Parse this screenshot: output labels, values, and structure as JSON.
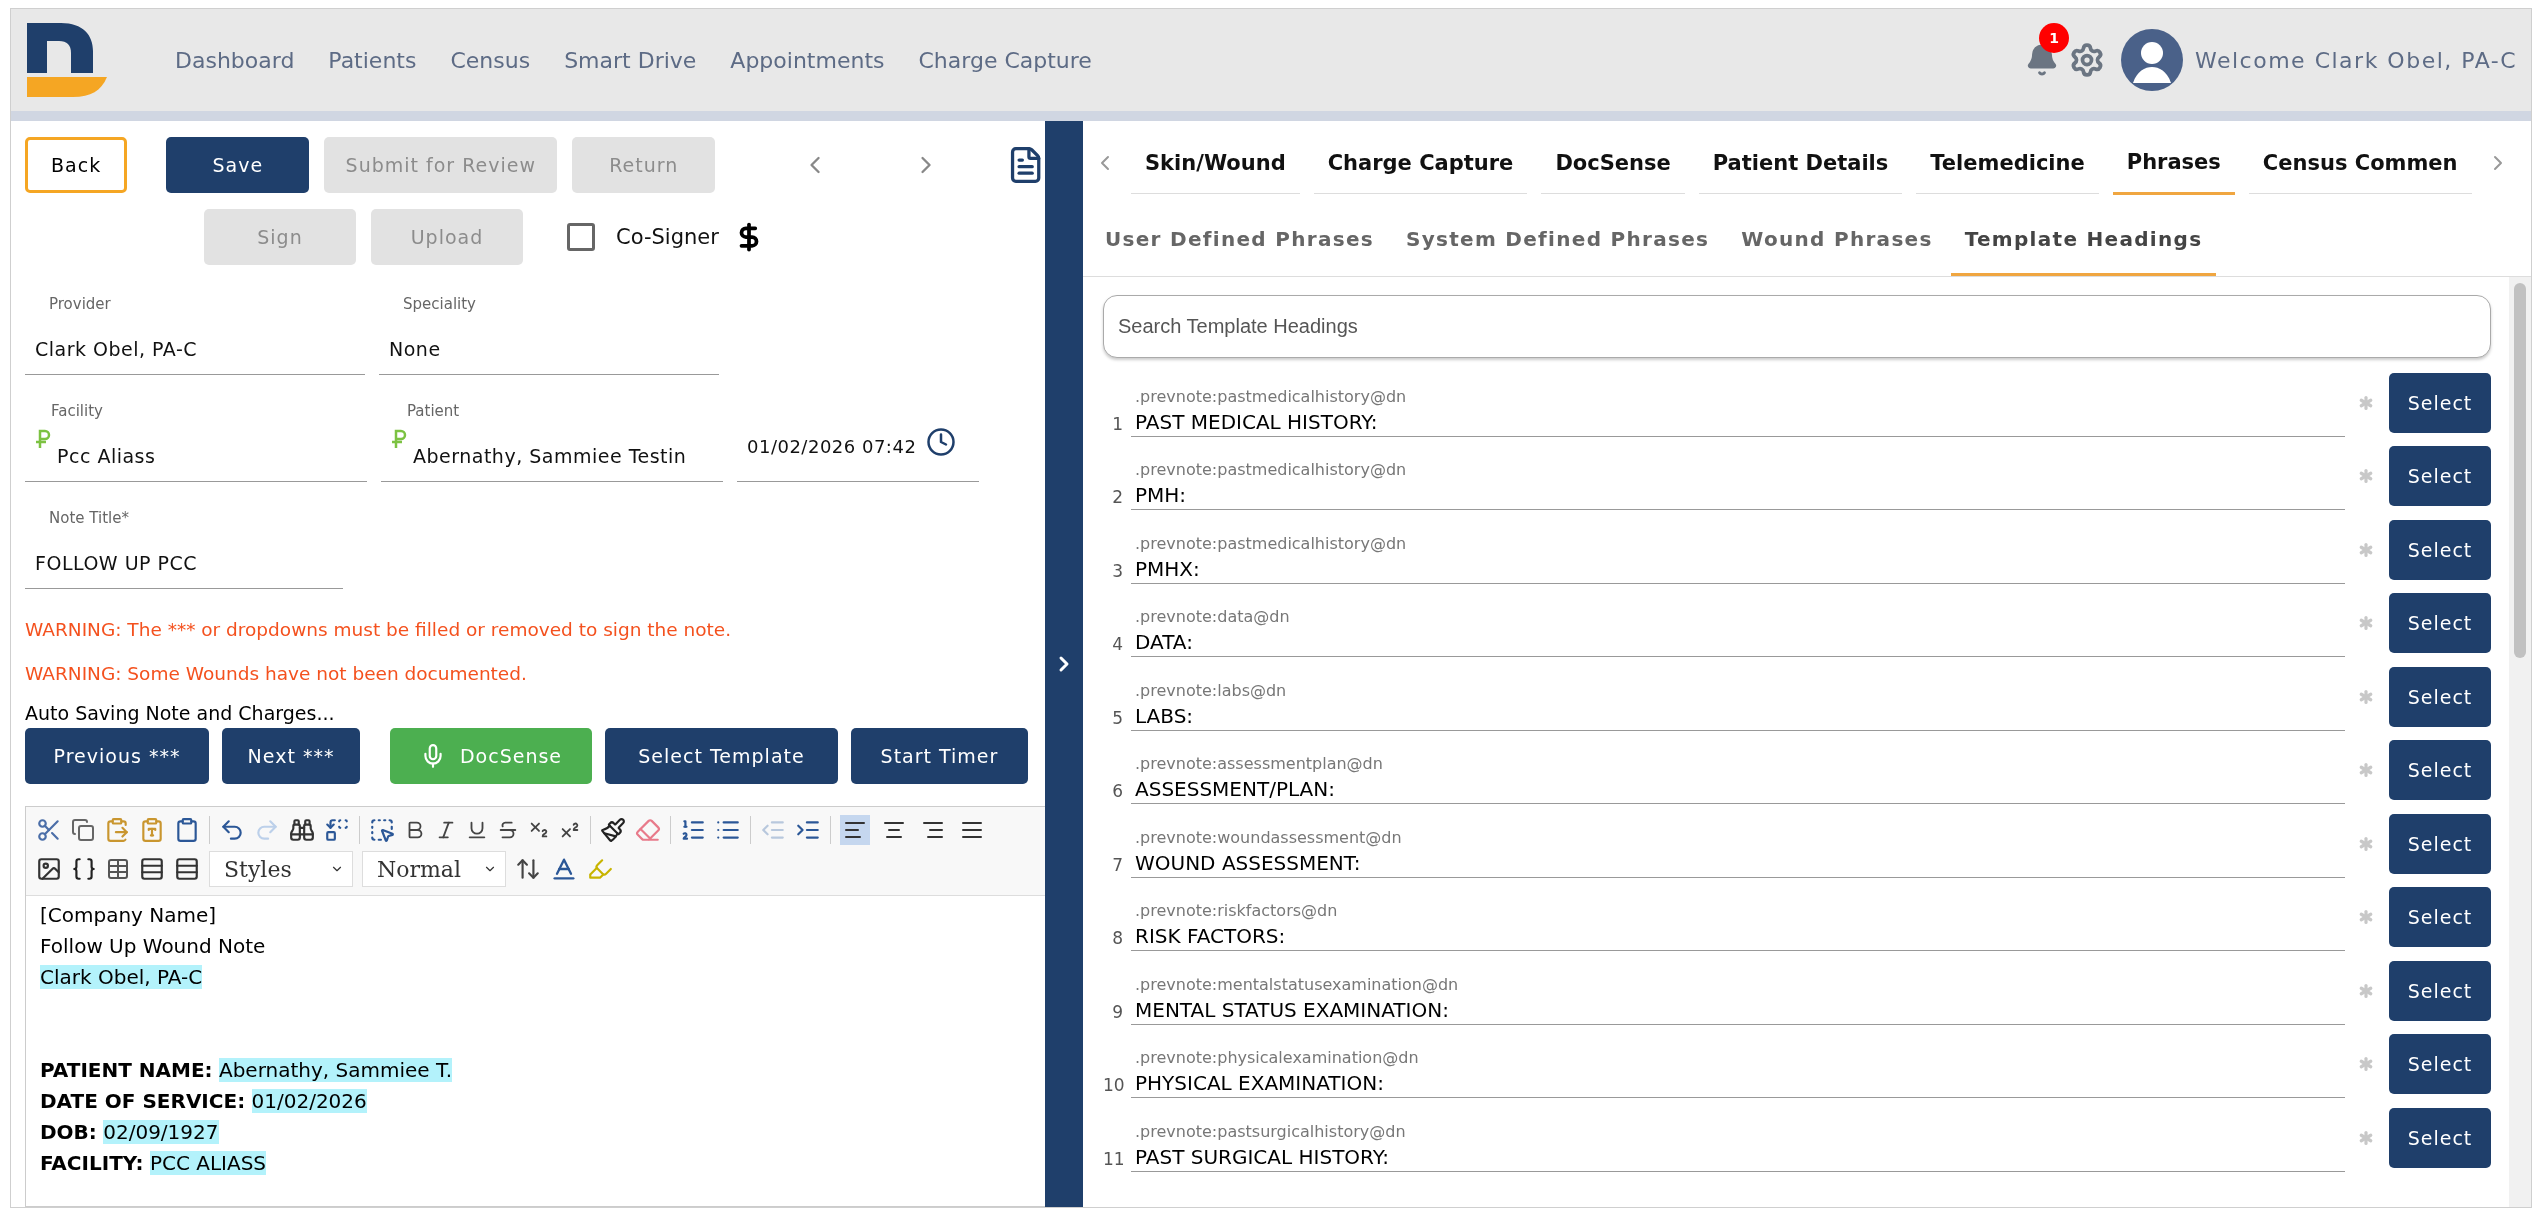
{
  "nav": {
    "items": [
      "Dashboard",
      "Patients",
      "Census",
      "Smart Drive",
      "Appointments",
      "Charge Capture"
    ],
    "notifications": "1",
    "welcome": "Welcome Clark Obel, PA-C"
  },
  "note": {
    "actions": [
      {
        "label": "Back",
        "kind": "outline",
        "disabled": false
      },
      {
        "label": "Save",
        "kind": "primary",
        "disabled": false
      },
      {
        "label": "Submit for Review",
        "kind": "primary",
        "disabled": true
      },
      {
        "label": "Return",
        "kind": "primary",
        "disabled": true
      }
    ],
    "actions_row2": [
      {
        "label": "Sign",
        "disabled": true
      },
      {
        "label": "Upload",
        "disabled": true
      }
    ],
    "cosigner": {
      "label": "Co-Signer",
      "checked": false
    },
    "field_rows": [
      [
        {
          "label": "Provider",
          "value": "Clark Obel, PA-C",
          "kind": "text"
        },
        {
          "label": "Speciality",
          "value": "None",
          "kind": "text"
        }
      ],
      [
        {
          "label": "Facility",
          "value": "Pcc Aliass",
          "kind": "linked"
        },
        {
          "label": "Patient",
          "value": "Abernathy, Sammiee Testin",
          "kind": "linked"
        },
        {
          "value": "01/02/2026 07:42",
          "kind": "date"
        }
      ],
      [
        {
          "label": "Note Title*",
          "value": "FOLLOW UP PCC",
          "kind": "text"
        }
      ]
    ],
    "warnings": [
      "WARNING: The *** or dropdowns must be filled or removed to sign the note.",
      "WARNING: Some Wounds have not been documented."
    ],
    "autosave": "Auto Saving Note and Charges...",
    "buttons": [
      {
        "label": "Previous ***",
        "kind": "primary"
      },
      {
        "label": "Next ***",
        "kind": "primary"
      },
      {
        "label": "DocSense",
        "kind": "voice"
      },
      {
        "label": "Select Template",
        "kind": "primary"
      },
      {
        "label": "Start Timer",
        "kind": "primary"
      }
    ]
  },
  "editor": {
    "styles": "Styles",
    "format": "Normal",
    "redo_disabled": true,
    "outdent_disabled": true,
    "alignments": [
      {
        "selected": true
      },
      {
        "selected": false
      },
      {
        "selected": false
      },
      {
        "selected": false
      }
    ],
    "header_lines": [
      {
        "text": "[Company Name]",
        "highlighted": false
      },
      {
        "text": "Follow Up Wound Note",
        "highlighted": false
      },
      {
        "text": "Clark Obel, PA-C",
        "highlighted": true
      }
    ],
    "fields": [
      {
        "label": "PATIENT NAME:",
        "value": "Abernathy, Sammiee T."
      },
      {
        "label": "DATE OF SERVICE:",
        "value": "01/02/2026"
      },
      {
        "label": "DOB:",
        "value": "02/09/1927"
      },
      {
        "label": "FACILITY:",
        "value": "PCC ALIASS"
      }
    ]
  },
  "phrases": {
    "tabs": [
      {
        "label": "Skin/Wound",
        "selected": false
      },
      {
        "label": "Charge Capture",
        "selected": false
      },
      {
        "label": "DocSense",
        "selected": false
      },
      {
        "label": "Patient Details",
        "selected": false
      },
      {
        "label": "Telemedicine",
        "selected": false
      },
      {
        "label": "Phrases",
        "selected": true
      },
      {
        "label": "Census Commen",
        "selected": false
      }
    ],
    "subtabs": [
      {
        "label": "User Defined Phrases",
        "selected": false
      },
      {
        "label": "System Defined Phrases",
        "selected": false
      },
      {
        "label": "Wound Phrases",
        "selected": false
      },
      {
        "label": "Template Headings",
        "selected": true
      }
    ],
    "search": {
      "placeholder": "Search Template Headings"
    },
    "rows": [
      {
        "number": "1",
        "code": ".prevnote:pastmedicalhistory@dn",
        "heading": "PAST MEDICAL HISTORY:",
        "button": "Select"
      },
      {
        "number": "2",
        "code": ".prevnote:pastmedicalhistory@dn",
        "heading": "PMH:",
        "button": "Select"
      },
      {
        "number": "3",
        "code": ".prevnote:pastmedicalhistory@dn",
        "heading": "PMHX:",
        "button": "Select"
      },
      {
        "number": "4",
        "code": ".prevnote:data@dn",
        "heading": "DATA:",
        "button": "Select"
      },
      {
        "number": "5",
        "code": ".prevnote:labs@dn",
        "heading": "LABS:",
        "button": "Select"
      },
      {
        "number": "6",
        "code": ".prevnote:assessmentplan@dn",
        "heading": "ASSESSMENT/PLAN:",
        "button": "Select"
      },
      {
        "number": "7",
        "code": ".prevnote:woundassessment@dn",
        "heading": "WOUND ASSESSMENT:",
        "button": "Select"
      },
      {
        "number": "8",
        "code": ".prevnote:riskfactors@dn",
        "heading": "RISK FACTORS:",
        "button": "Select"
      },
      {
        "number": "9",
        "code": ".prevnote:mentalstatusexamination@dn",
        "heading": "MENTAL STATUS EXAMINATION:",
        "button": "Select"
      },
      {
        "number": "10",
        "code": ".prevnote:physicalexamination@dn",
        "heading": "PHYSICAL EXAMINATION:",
        "button": "Select"
      },
      {
        "number": "11",
        "code": ".prevnote:pastsurgicalhistory@dn",
        "heading": "PAST SURGICAL HISTORY:",
        "button": "Select"
      }
    ]
  }
}
